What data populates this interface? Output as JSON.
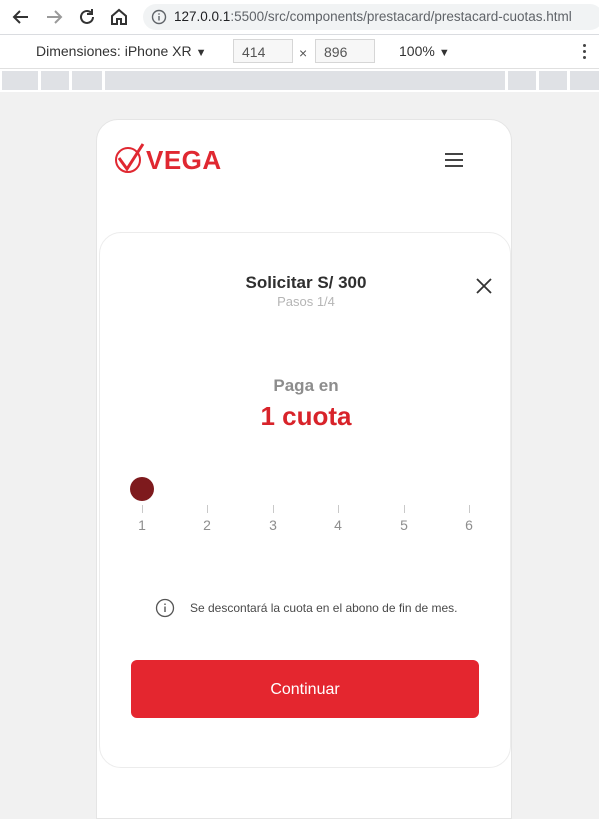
{
  "browser": {
    "url_host": "127.0.0.1",
    "url_path": ":5500/src/components/prestacard/prestacard-cuotas.html"
  },
  "devtools": {
    "dimensions_label": "Dimensiones: iPhone XR",
    "width_value": "414",
    "height_value": "896",
    "dim_separator": "×",
    "zoom": "100%"
  },
  "header": {
    "logo_text": "VEGA"
  },
  "card": {
    "title": "Solicitar S/ 300",
    "subtitle": "Pasos 1/4",
    "pay_label": "Paga en",
    "pay_value": "1 cuota",
    "slider": {
      "ticks": [
        "1",
        "2",
        "3",
        "4",
        "5",
        "6"
      ],
      "selected": "1"
    },
    "info_text": "Se descontará la cuota en el abono de fin de mes.",
    "continue_label": "Continuar"
  },
  "colors": {
    "brand_red": "#e4262f",
    "thumb": "#7e1a1d",
    "value_red": "#d8232a"
  }
}
